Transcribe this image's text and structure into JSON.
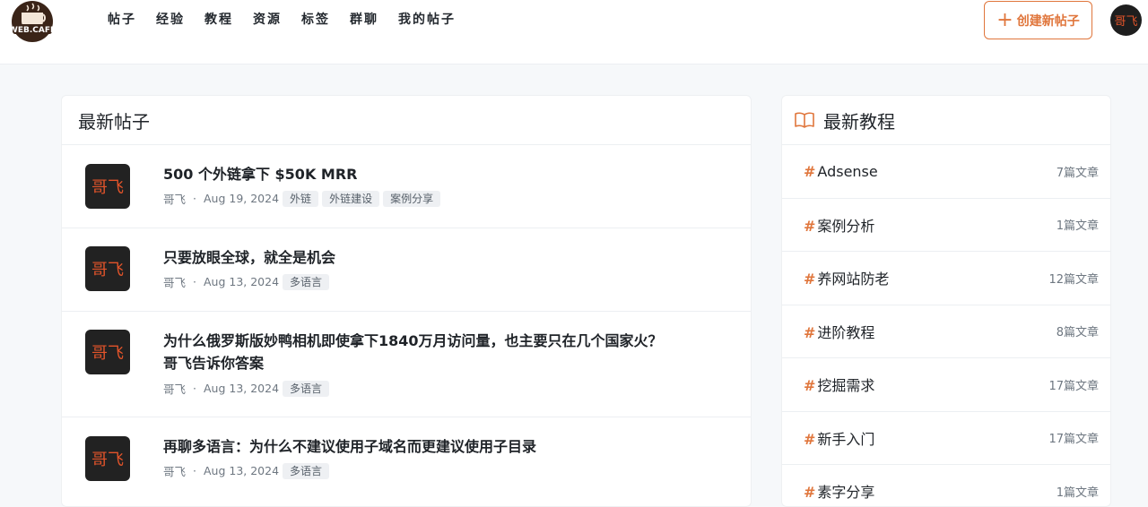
{
  "header": {
    "logo_text": "WEB.CAFE",
    "nav": [
      "帖子",
      "经验",
      "教程",
      "资源",
      "标签",
      "群聊",
      "我的帖子"
    ],
    "create_label": "创建新帖子",
    "avatar_text": "哥飞"
  },
  "posts": {
    "title": "最新帖子",
    "items": [
      {
        "title": "500 个外链拿下 $50K MRR",
        "author": "哥飞",
        "date": "Aug 19, 2024",
        "tags": [
          "外链",
          "外链建设",
          "案例分享"
        ],
        "avatar": "哥飞"
      },
      {
        "title": "只要放眼全球，就全是机会",
        "author": "哥飞",
        "date": "Aug 13, 2024",
        "tags": [
          "多语言"
        ],
        "avatar": "哥飞"
      },
      {
        "title": "为什么俄罗斯版妙鸭相机即使拿下1840万月访问量，也主要只在几个国家火？哥飞告诉你答案",
        "author": "哥飞",
        "date": "Aug 13, 2024",
        "tags": [
          "多语言"
        ],
        "avatar": "哥飞"
      },
      {
        "title": "再聊多语言：为什么不建议使用子域名而更建议使用子目录",
        "author": "哥飞",
        "date": "Aug 13, 2024",
        "tags": [
          "多语言"
        ],
        "avatar": "哥飞"
      }
    ]
  },
  "tutorials": {
    "title": "最新教程",
    "items": [
      {
        "name": "Adsense",
        "count": "7篇文章"
      },
      {
        "name": "案例分析",
        "count": "1篇文章"
      },
      {
        "name": "养网站防老",
        "count": "12篇文章"
      },
      {
        "name": "进阶教程",
        "count": "8篇文章"
      },
      {
        "name": "挖掘需求",
        "count": "17篇文章"
      },
      {
        "name": "新手入门",
        "count": "17篇文章"
      },
      {
        "name": "素字分享",
        "count": "1篇文章"
      }
    ]
  },
  "colors": {
    "accent": "#e0763c",
    "avatar_bg": "#222222",
    "avatar_text": "#e3542a"
  }
}
